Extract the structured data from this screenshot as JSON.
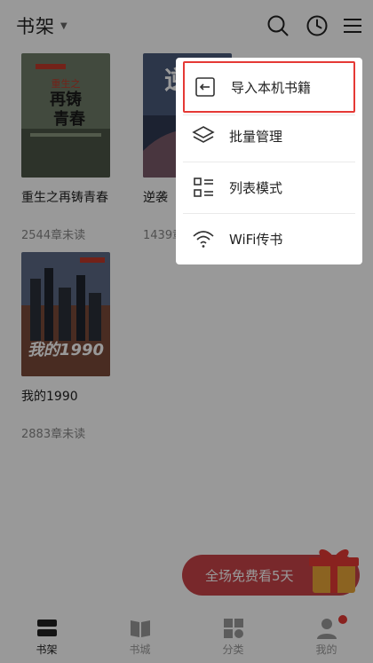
{
  "header": {
    "title": "书架",
    "icons": [
      "search-icon",
      "history-icon",
      "menu-icon"
    ]
  },
  "shelf": {
    "books": [
      {
        "title": "重生之再铸青春",
        "progress": "2544章未读",
        "cover_text": "重生之\n再铸\n青春",
        "cover_author": "医疗水稿"
      },
      {
        "title": "逆袭",
        "progress": "1439章未读",
        "cover_text": "逆"
      },
      {
        "title": "我的1990",
        "progress": "2883章未读",
        "cover_text": "我的1990"
      }
    ]
  },
  "menu": {
    "items": [
      {
        "label": "导入本机书籍",
        "icon": "import-icon",
        "highlighted": true
      },
      {
        "label": "批量管理",
        "icon": "layers-icon"
      },
      {
        "label": "列表模式",
        "icon": "list-mode-icon"
      },
      {
        "label": "WiFi传书",
        "icon": "wifi-icon"
      }
    ]
  },
  "promo": {
    "text": "全场免费看5天",
    "color": "#c94448"
  },
  "nav": {
    "items": [
      {
        "label": "书架",
        "icon": "bookshelf-icon",
        "active": true
      },
      {
        "label": "书城",
        "icon": "book-open-icon"
      },
      {
        "label": "分类",
        "icon": "category-icon"
      },
      {
        "label": "我的",
        "icon": "person-icon",
        "badge": true
      }
    ]
  },
  "colors": {
    "accent": "#e53935",
    "overlay": "rgba(0,0,0,0.40)"
  }
}
